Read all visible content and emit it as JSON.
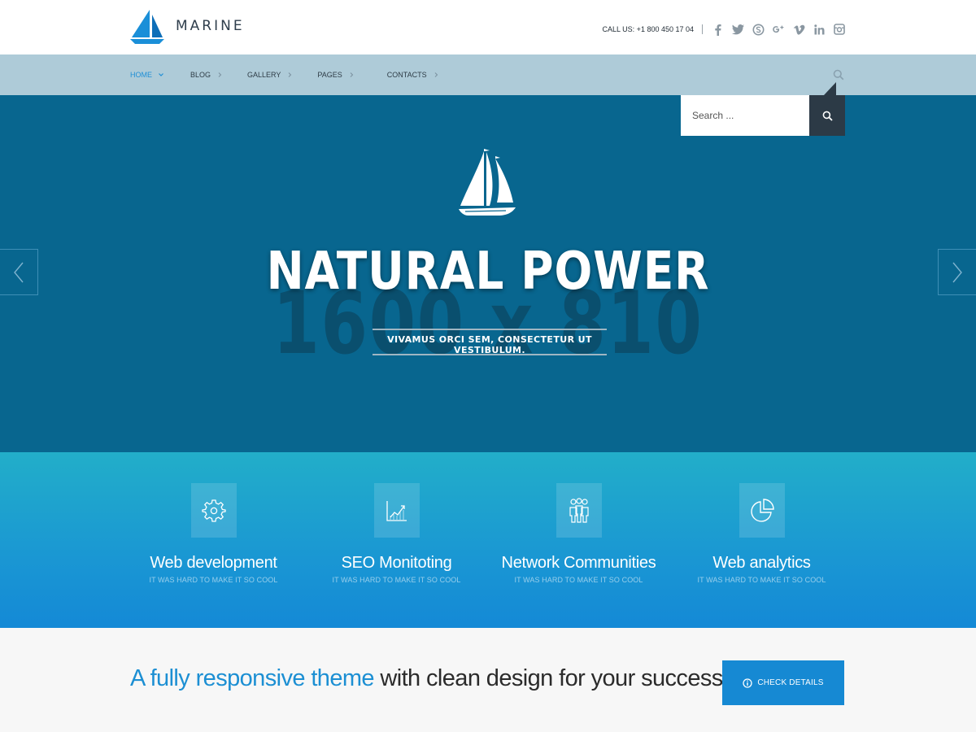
{
  "header": {
    "logo_text": "MARINE",
    "phone": "CALL US: +1 800 450 17 04",
    "social_icons": [
      "facebook-icon",
      "twitter-icon",
      "skype-icon",
      "google-plus-icon",
      "vimeo-icon",
      "linkedin-icon",
      "instagram-icon"
    ]
  },
  "nav": {
    "items": [
      {
        "label": "HOME",
        "active": true
      },
      {
        "label": "BLOG",
        "active": false
      },
      {
        "label": "GALLERY",
        "active": false
      },
      {
        "label": "PAGES",
        "active": false
      },
      {
        "label": "CONTACTS",
        "active": false
      }
    ]
  },
  "search": {
    "placeholder": "Search ..."
  },
  "hero": {
    "placeholder_text": "1600 x 810",
    "title": "NATURAL POWER",
    "subtitle": "VIVAMUS ORCI SEM, CONSECTETUR UT VESTIBULUM."
  },
  "services": [
    {
      "title": "Web development",
      "subtitle": "IT WAS HARD TO MAKE IT SO COOL",
      "icon": "gear-icon"
    },
    {
      "title": "SEO Monitoting",
      "subtitle": "IT WAS HARD TO MAKE IT SO COOL",
      "icon": "chart-icon"
    },
    {
      "title": "Network Communities",
      "subtitle": "IT WAS HARD TO MAKE IT SO COOL",
      "icon": "people-icon"
    },
    {
      "title": "Web analytics",
      "subtitle": "IT WAS HARD TO MAKE IT SO COOL",
      "icon": "pie-chart-icon"
    }
  ],
  "cta": {
    "highlight": "A fully responsive theme",
    "rest": " with clean design for your success!",
    "button_label": "CHECK DETAILS"
  },
  "colors": {
    "accent": "#1c8fd3",
    "nav_bg": "#aecbd8",
    "hero_bg": "#08668f",
    "dark": "#2c3a46"
  }
}
